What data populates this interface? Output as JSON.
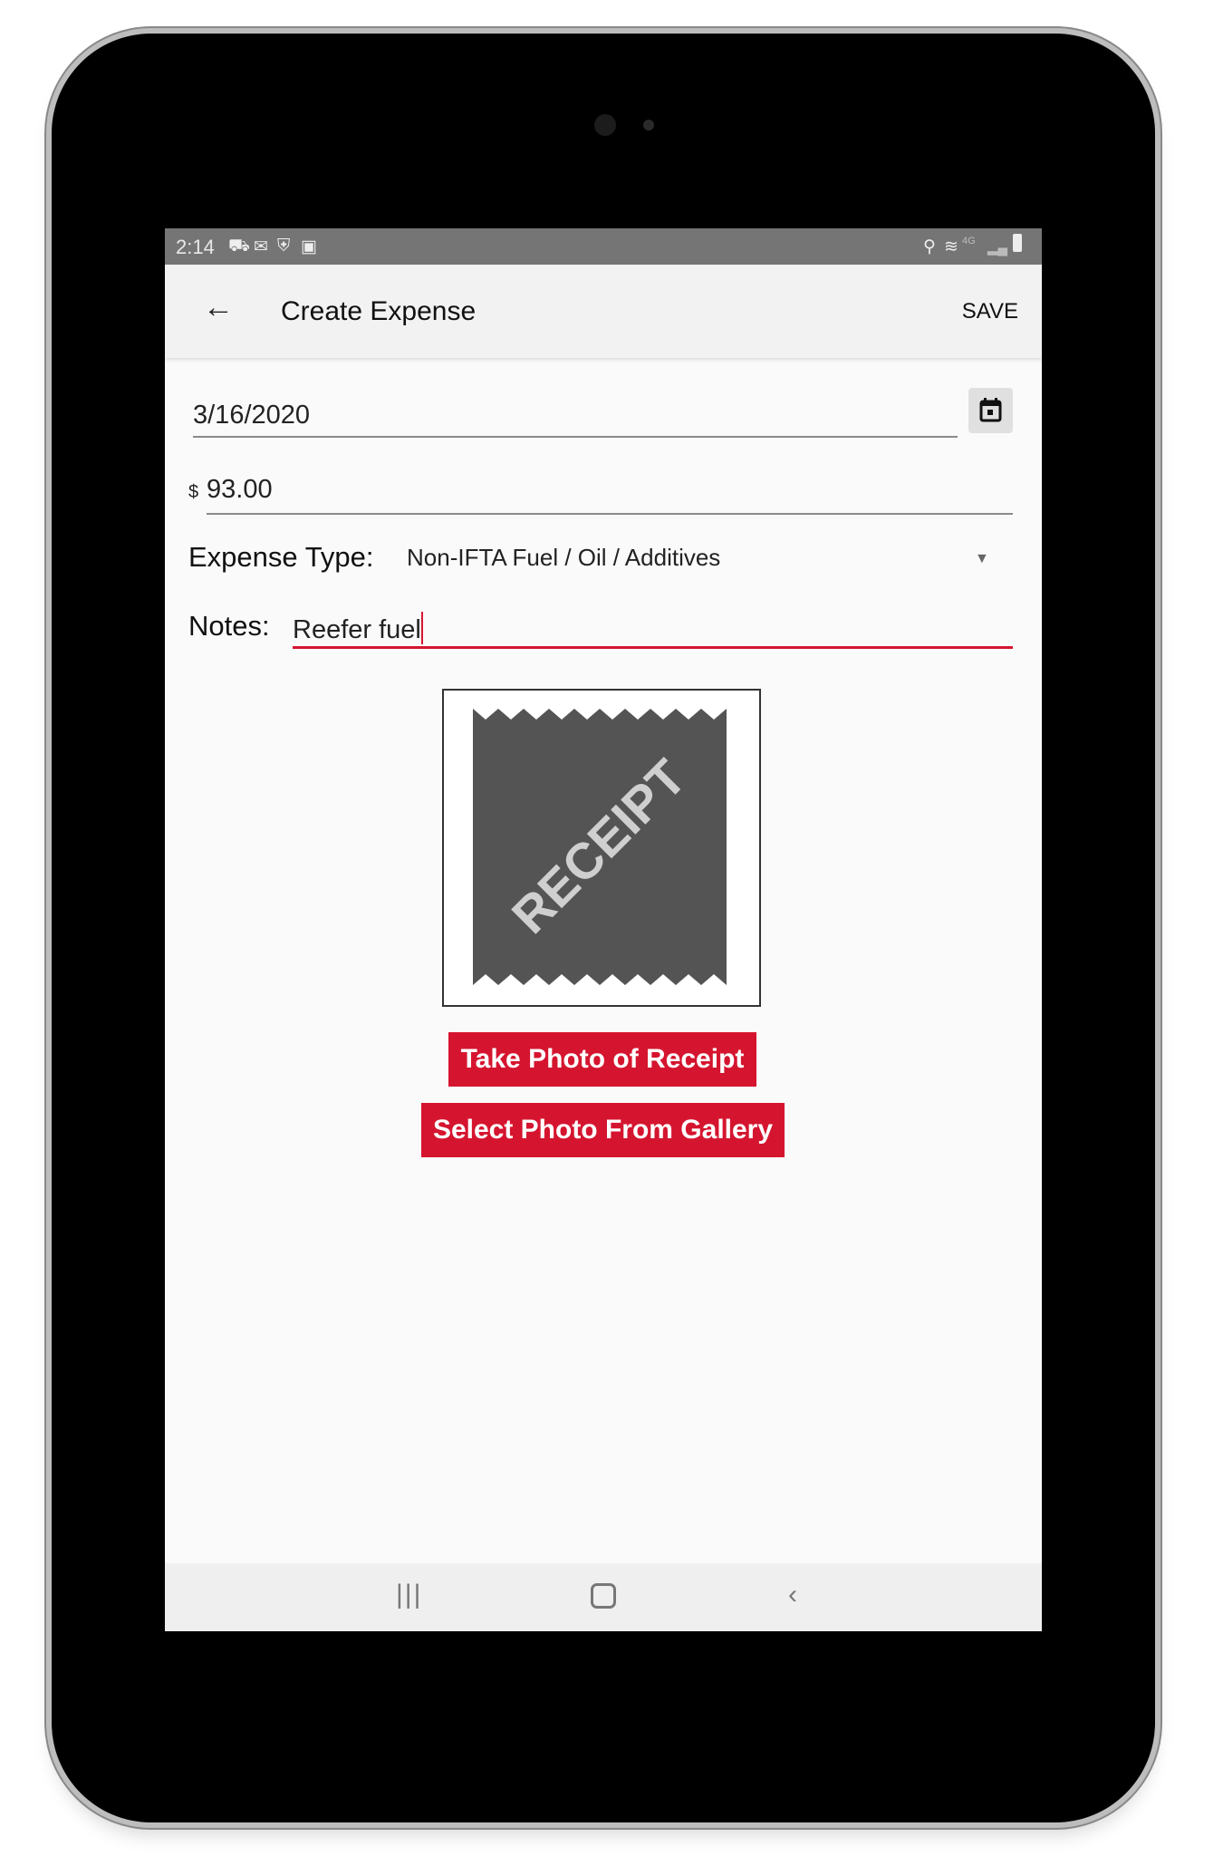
{
  "status_bar": {
    "time": "2:14",
    "left_icons": [
      "truck-icon",
      "gmail-icon",
      "shield-icon",
      "image-icon"
    ],
    "right_icons": [
      "location-icon",
      "wifi-icon",
      "4g-icon",
      "signal-icon",
      "battery-icon"
    ],
    "network": "4G"
  },
  "app_bar": {
    "title": "Create Expense",
    "save_label": "SAVE"
  },
  "form": {
    "date": "3/16/2020",
    "currency_symbol": "$",
    "amount": "93.00",
    "expense_type_label": "Expense Type:",
    "expense_type_value": "Non-IFTA Fuel / Oil / Additives",
    "notes_label": "Notes:",
    "notes_value": "Reefer fuel"
  },
  "receipt_image": {
    "text": "RECEIPT"
  },
  "buttons": {
    "take_photo": "Take Photo of Receipt",
    "select_gallery": "Select Photo From Gallery"
  },
  "colors": {
    "accent": "#d5152f",
    "status_bar": "#757575",
    "app_bar": "#f2f2f2"
  }
}
